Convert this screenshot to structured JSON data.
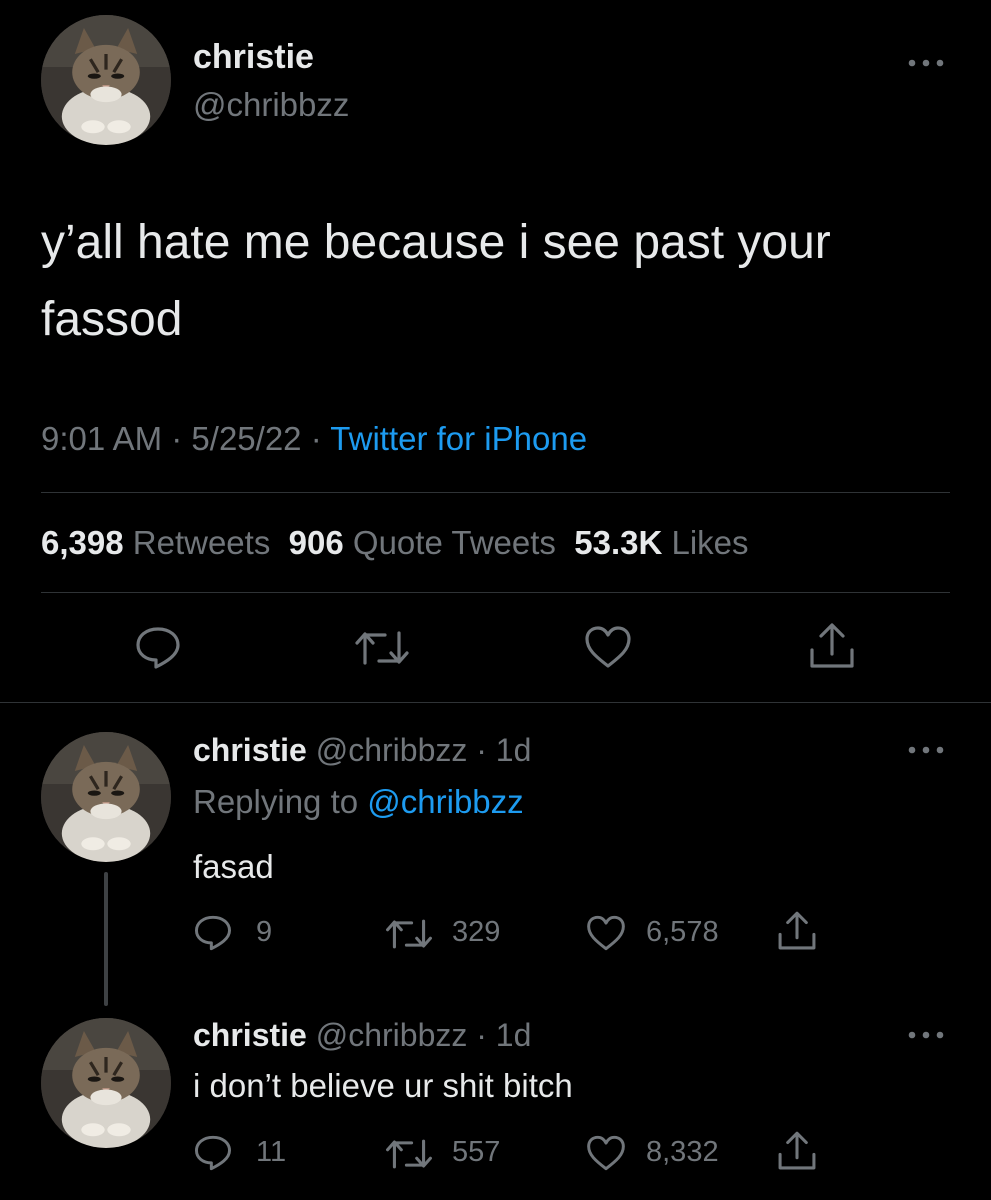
{
  "main_tweet": {
    "name": "christie",
    "handle": "@chribbzz",
    "text_line1": "y’all hate me because i see past your",
    "text_line2": "fassod",
    "time": "9:01 AM",
    "date": "5/25/22",
    "source": "Twitter for iPhone",
    "separator": "·",
    "retweets_count": "6,398",
    "retweets_label": "Retweets",
    "quotes_count": "906",
    "quotes_label": "Quote Tweets",
    "likes_count": "53.3K",
    "likes_label": "Likes"
  },
  "replies": [
    {
      "name": "christie",
      "handle": "@chribbzz",
      "age": "· 1d",
      "replying_prefix": "Replying to",
      "replying_handle": "@chribbzz",
      "text": "fasad",
      "reply_count": "9",
      "retweet_count": "329",
      "like_count": "6,578"
    },
    {
      "name": "christie",
      "handle": "@chribbzz",
      "age": "· 1d",
      "text": "i don’t believe ur shit bitch",
      "reply_count": "11",
      "retweet_count": "557",
      "like_count": "8,332"
    }
  ],
  "icons": {
    "reply": "reply-icon",
    "retweet": "retweet-icon",
    "like": "like-icon",
    "share": "share-icon",
    "more": "more-icon"
  },
  "colors": {
    "background": "#000000",
    "text": "#e7e9ea",
    "secondary": "#71767b",
    "link": "#1d9bf0",
    "divider": "#2f3336"
  }
}
